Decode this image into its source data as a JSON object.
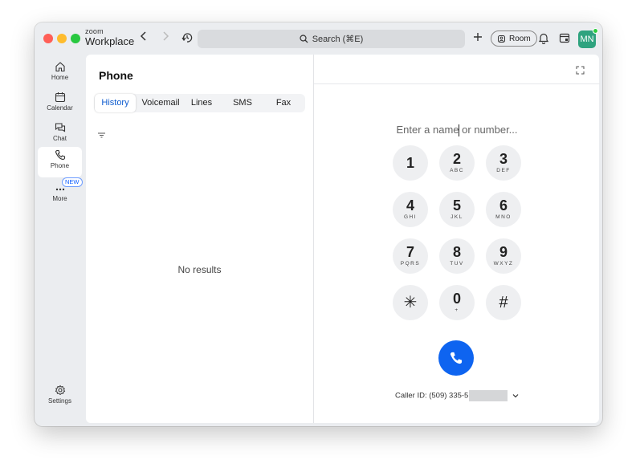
{
  "app": {
    "brand_small": "zoom",
    "brand_big": "Workplace"
  },
  "titlebar": {
    "search_label": "Search (⌘E)",
    "room_label": "Room",
    "avatar_initials": "MN"
  },
  "sidebar": {
    "items": [
      {
        "label": "Home",
        "icon": "home-icon"
      },
      {
        "label": "Calendar",
        "icon": "calendar-icon"
      },
      {
        "label": "Chat",
        "icon": "chat-icon"
      },
      {
        "label": "Phone",
        "icon": "phone-icon",
        "active": true
      },
      {
        "label": "More",
        "icon": "more-icon",
        "badge": "NEW"
      }
    ],
    "settings_label": "Settings"
  },
  "phone": {
    "title": "Phone",
    "tabs": [
      "History",
      "Voicemail",
      "Lines",
      "SMS",
      "Fax"
    ],
    "active_tab": "History",
    "empty_text": "No results"
  },
  "dialpad": {
    "placeholder": "Enter a name or number...",
    "keys": [
      {
        "digit": "1",
        "letters": ""
      },
      {
        "digit": "2",
        "letters": "ABC"
      },
      {
        "digit": "3",
        "letters": "DEF"
      },
      {
        "digit": "4",
        "letters": "GHI"
      },
      {
        "digit": "5",
        "letters": "JKL"
      },
      {
        "digit": "6",
        "letters": "MNO"
      },
      {
        "digit": "7",
        "letters": "PQRS"
      },
      {
        "digit": "8",
        "letters": "TUV"
      },
      {
        "digit": "9",
        "letters": "WXYZ"
      },
      {
        "digit": "✳",
        "letters": ""
      },
      {
        "digit": "0",
        "letters": "+"
      },
      {
        "digit": "#",
        "letters": ""
      }
    ],
    "caller_id_label": "Caller ID: (509) 335-5",
    "colors": {
      "call": "#0e64f0",
      "tab_active": "#0e5ccf",
      "avatar": "#2fa37f"
    }
  }
}
